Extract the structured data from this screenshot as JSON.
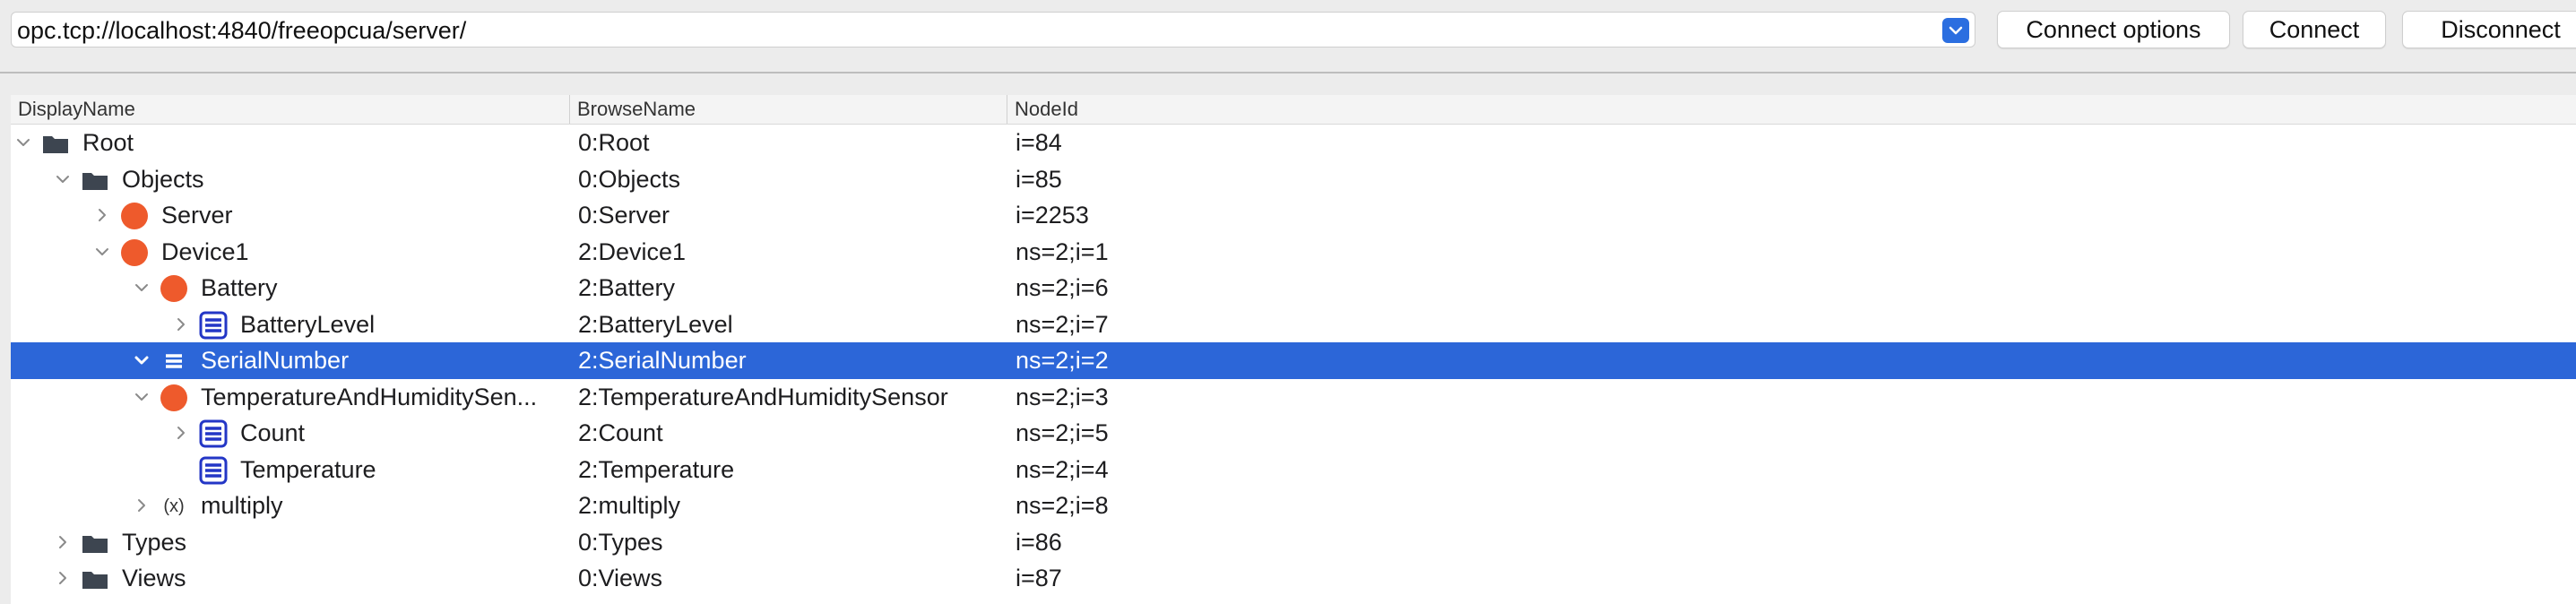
{
  "toolbar": {
    "url": "opc.tcp://localhost:4840/freeopcua/server/",
    "connect_options_label": "Connect options",
    "connect_label": "Connect",
    "disconnect_label": "Disconnect"
  },
  "columns": {
    "display_name": "DisplayName",
    "browse_name": "BrowseName",
    "node_id": "NodeId"
  },
  "rows": [
    {
      "display": "Root",
      "browse": "0:Root",
      "nodeid": "i=84",
      "icon": "folder-icon",
      "expand": "expanded",
      "depth": 0
    },
    {
      "display": "Objects",
      "browse": "0:Objects",
      "nodeid": "i=85",
      "icon": "folder-icon",
      "expand": "expanded",
      "depth": 1
    },
    {
      "display": "Server",
      "browse": "0:Server",
      "nodeid": "i=2253",
      "icon": "object-icon",
      "expand": "collapsed",
      "depth": 2
    },
    {
      "display": "Device1",
      "browse": "2:Device1",
      "nodeid": "ns=2;i=1",
      "icon": "object-icon",
      "expand": "expanded",
      "depth": 2
    },
    {
      "display": "Battery",
      "browse": "2:Battery",
      "nodeid": "ns=2;i=6",
      "icon": "object-icon",
      "expand": "expanded",
      "depth": 3
    },
    {
      "display": "BatteryLevel",
      "browse": "2:BatteryLevel",
      "nodeid": "ns=2;i=7",
      "icon": "variable-icon",
      "expand": "collapsed",
      "depth": 4
    },
    {
      "display": "SerialNumber",
      "browse": "2:SerialNumber",
      "nodeid": "ns=2;i=2",
      "icon": "variable-icon",
      "expand": "expanded",
      "depth": 3,
      "selected": true
    },
    {
      "display": "TemperatureAndHumiditySen...",
      "browse": "2:TemperatureAndHumiditySensor",
      "nodeid": "ns=2;i=3",
      "icon": "object-icon",
      "expand": "expanded",
      "depth": 3
    },
    {
      "display": "Count",
      "browse": "2:Count",
      "nodeid": "ns=2;i=5",
      "icon": "variable-icon",
      "expand": "collapsed",
      "depth": 4
    },
    {
      "display": "Temperature",
      "browse": "2:Temperature",
      "nodeid": "ns=2;i=4",
      "icon": "variable-icon",
      "expand": "none",
      "depth": 4
    },
    {
      "display": "multiply",
      "browse": "2:multiply",
      "nodeid": "ns=2;i=8",
      "icon": "method-icon",
      "method_glyph": "(x)",
      "expand": "collapsed",
      "depth": 3
    },
    {
      "display": "Types",
      "browse": "0:Types",
      "nodeid": "i=86",
      "icon": "folder-icon",
      "expand": "collapsed",
      "depth": 1
    },
    {
      "display": "Views",
      "browse": "0:Views",
      "nodeid": "i=87",
      "icon": "folder-icon",
      "expand": "collapsed",
      "depth": 1
    }
  ],
  "colors": {
    "selection": "#2c66d8",
    "object": "#ee5a2c",
    "variable": "#2336c6",
    "folder": "#3d4550",
    "accent": "#2b6ee0"
  }
}
